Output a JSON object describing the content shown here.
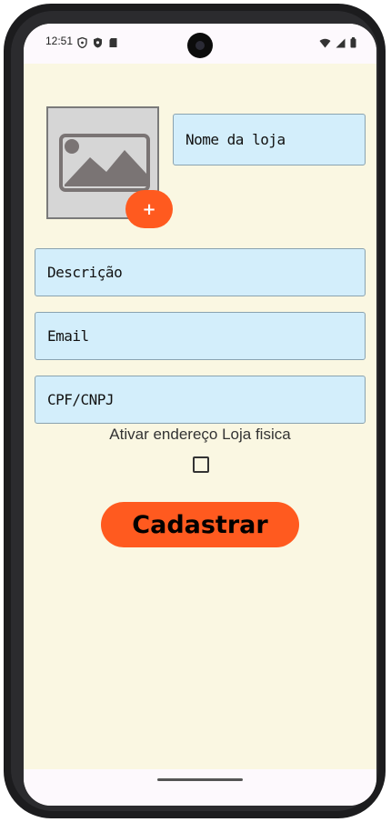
{
  "status_bar": {
    "time": "12:51",
    "left_icons": [
      "shield-icon",
      "shield-icon",
      "sd-card-icon"
    ],
    "right_icons": [
      "wifi-icon",
      "signal-icon",
      "battery-icon"
    ]
  },
  "store_form": {
    "image_placeholder_icon": "image-placeholder-icon",
    "add_image_label": "+",
    "fields": {
      "nome": "Nome da loja",
      "descricao": "Descrição",
      "email": "Email",
      "cpf_cnpj": "CPF/CNPJ"
    },
    "toggle_label": "Ativar endereço Loja fisica",
    "toggle_checked": false,
    "submit_label": "Cadastrar"
  },
  "colors": {
    "background": "#faf7e2",
    "field_background": "#d3eefb",
    "accent": "#ff5a1f"
  }
}
